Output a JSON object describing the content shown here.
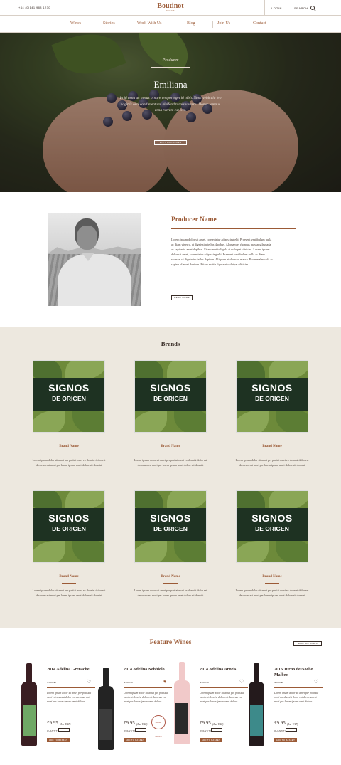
{
  "topbar": {
    "phone": "+44 (0)141 988 1230",
    "logo": "Boutinot",
    "logo_sub": "WINES",
    "login": "LOGIN",
    "search": "SEARCH"
  },
  "nav": [
    "Wines",
    "Stories",
    "Work With Us",
    "Blog",
    "Join Us",
    "Contact"
  ],
  "hero": {
    "kicker": "Producer",
    "title": "Emiliana",
    "text": "In id urna ac metus ornare tempor eget id nibh. Nunc vehicula leo sagittis orci condimentum, eleifend turpis viverra. Donec tempus urna rutrum est lect.",
    "button": "VISIT PRODUCER"
  },
  "producer": {
    "name": "Producer Name",
    "bio": "Lorem ipsum dolor sit amet, consectetur adipiscing elit. Praesent vestibulum nulla ac diam viverra, ut dignissim tellus dapibus. Aliquam et rhoncus massamalesuada ac sapien id amet dapibus. Etiam mattis ligula at volutpat ultricies. Lorem ipsum dolor sit amet, consectetur adipiscing elit. Praesent vestibulum nulla ac diam viverra, ut dignissim tellus dapibus. Aliquam et rhoncus massa. Proin malesuada ac sapien id amet dapibus. Etiam mattis ligula at volutpat ultricies.",
    "button": "READ MORE"
  },
  "brands": {
    "title": "Brands",
    "items": [
      {
        "logo1": "SIGNOS",
        "logo2": "DE ORIGEN",
        "name": "Brand Name",
        "desc": "Lorem ipsum dolor sit amet per partiat mori ex donnist dolor est decorum est mori per lorem ipsum amet dolore sit donnist"
      },
      {
        "logo1": "SIGNOS",
        "logo2": "DE ORIGEN",
        "name": "Brand Name",
        "desc": "Lorem ipsum dolor sit amet per partiat mori ex donnist dolor est decorum est mori per lorem ipsum amet dolore sit donnist"
      },
      {
        "logo1": "SIGNOS",
        "logo2": "DE ORIGEN",
        "name": "Brand Name",
        "desc": "Lorem ipsum dolor sit amet per partiat mori ex donnist dolor est decorum est mori per lorem ipsum amet dolore sit donnist"
      },
      {
        "logo1": "SIGNOS",
        "logo2": "DE ORIGEN",
        "name": "Brand Name",
        "desc": "Lorem ipsum dolor sit amet per partiat mori ex donnist dolor est decorum est mori per lorem ipsum amet dolore sit donnist"
      },
      {
        "logo1": "SIGNOS",
        "logo2": "DE ORIGEN",
        "name": "Brand Name",
        "desc": "Lorem ipsum dolor sit amet per partiat mori ex donnist dolor est decorum est mori per lorem ipsum amet dolore sit donnist"
      },
      {
        "logo1": "SIGNOS",
        "logo2": "DE ORIGEN",
        "name": "Brand Name",
        "desc": "Lorem ipsum dolor sit amet per partiat mori ex donnist dolor est decorum est mori per lorem ipsum amet dolore sit donnist"
      }
    ]
  },
  "feature_wines": {
    "title": "Feature Wines",
    "button": "SHOP ALL WINES",
    "items": [
      {
        "name": "2014 Adelina Grenache",
        "origin": "NAKDEI",
        "desc": "Lorem ipsum dolor sit amet per potissut mori est donnist dolor est decorum est mori per lorem ipsum amet dolore",
        "price": "£9.95",
        "vat": "(Inc VAT)",
        "qty": "QUANTITY",
        "basket": "ADD TO BASKET",
        "favourite": false,
        "bottle_color": "#3a1e22",
        "label_color": "#6fa865"
      },
      {
        "name": "2014 Adelina Nebbiolo",
        "origin": "NAKDEI",
        "desc": "Lorem ipsum dolor sit amet per potissut mori est donnist dolor est decorum est mori per lorem ipsum amet dolore",
        "price": "£9.95",
        "vat": "(Inc VAT)",
        "qty": "QUANTITY",
        "basket": "ADD TO BASKET",
        "favourite": true,
        "bottle_color": "#232323",
        "label_color": "#3c3c3c",
        "badge": "AWARD WINNER"
      },
      {
        "name": "2014 Adelina Arneis",
        "origin": "NAKDEI",
        "desc": "Lorem ipsum dolor sit amet per potissut mori est donnist dolor est decorum est mori per lorem ipsum amet dolore",
        "price": "£9.95",
        "vat": "(Inc VAT)",
        "qty": "QUANTITY",
        "basket": "ADD TO BASKET",
        "favourite": false,
        "bottle_color": "#f1c9c9",
        "label_color": "#2a2a2a"
      },
      {
        "name": "2016 Turno de Noche Malbec",
        "origin": "NAKDEI",
        "desc": "Lorem ipsum dolor sit amet per potissut mori est donnist dolor est decorum est mori per lorem ipsum amet dolore",
        "price": "£9.95",
        "vat": "(Inc VAT)",
        "qty": "QUANTITY",
        "basket": "ADD TO BASKET",
        "favourite": false,
        "bottle_color": "#241a1c",
        "label_color": "#3d8a8a"
      }
    ]
  },
  "colors": {
    "accent": "#9b5a36",
    "beige": "#ede8df",
    "brand_band": "#1e3222"
  }
}
